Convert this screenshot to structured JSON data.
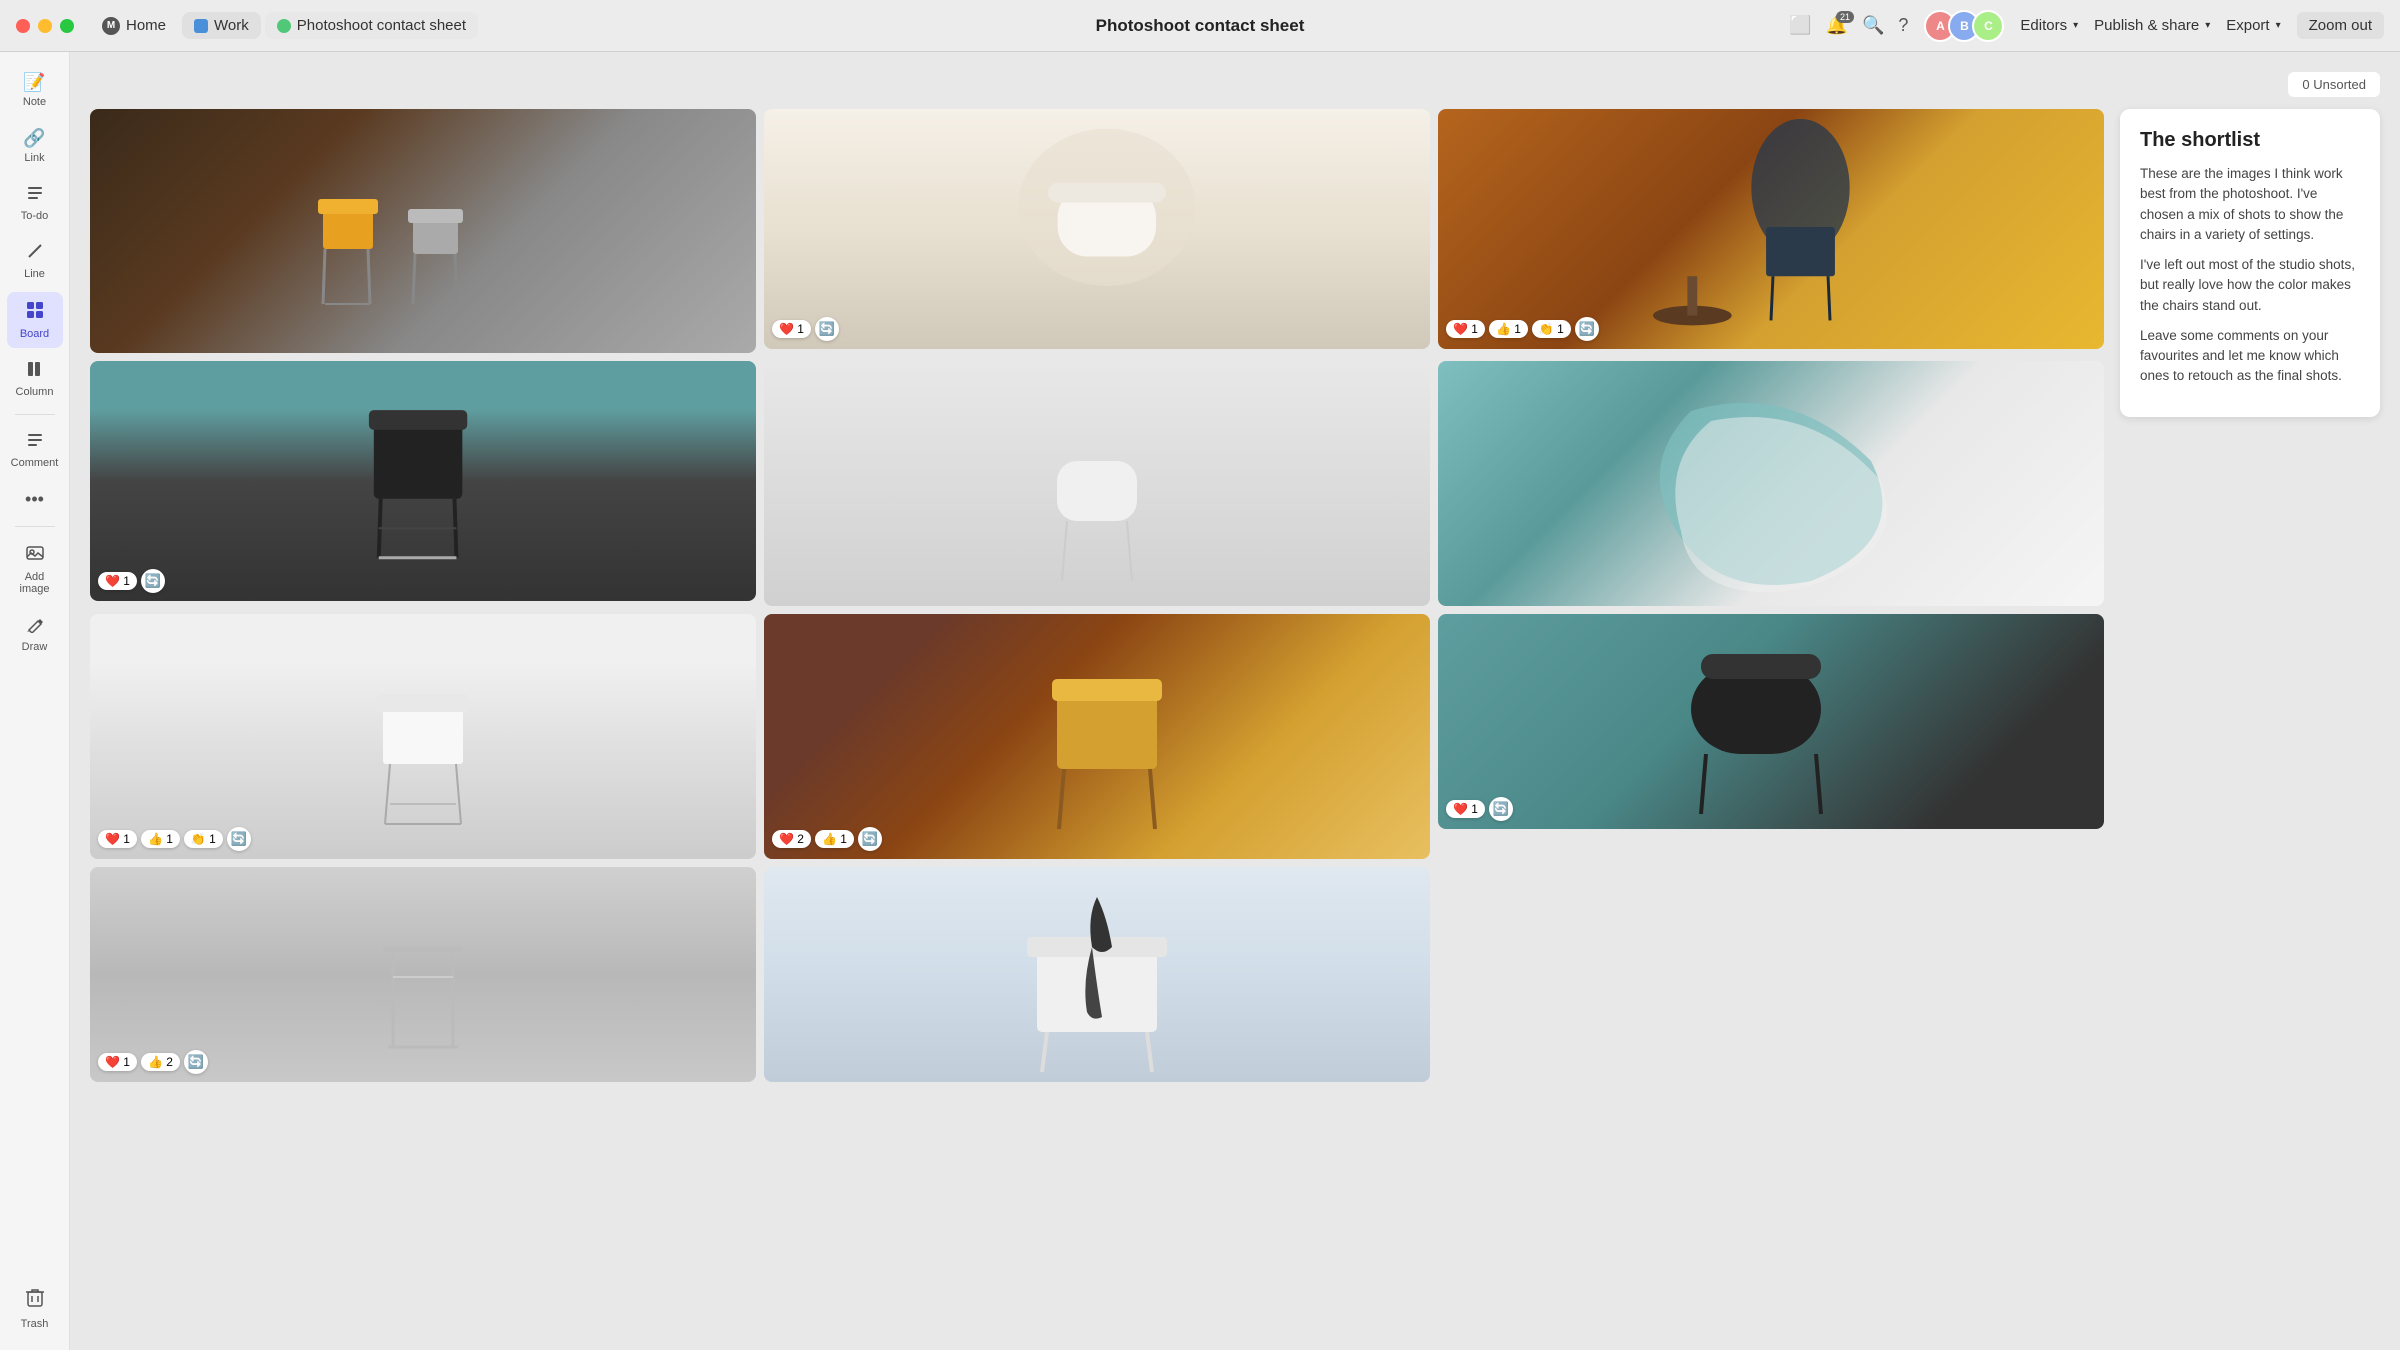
{
  "titlebar": {
    "tabs": [
      {
        "id": "home",
        "label": "Home",
        "icon": "M"
      },
      {
        "id": "work",
        "label": "Work",
        "icon": "work"
      },
      {
        "id": "doc",
        "label": "Photoshoot contact sheet",
        "icon": "doc"
      }
    ],
    "center_title": "Photoshoot contact sheet",
    "notification_count": "21",
    "editors_label": "Editors",
    "publish_label": "Publish & share",
    "export_label": "Export",
    "zoomout_label": "Zoom out"
  },
  "sidebar": {
    "items": [
      {
        "id": "note",
        "label": "Note",
        "icon": "☰"
      },
      {
        "id": "link",
        "label": "Link",
        "icon": "🔗"
      },
      {
        "id": "todo",
        "label": "To-do",
        "icon": "≡"
      },
      {
        "id": "line",
        "label": "Line",
        "icon": "/"
      },
      {
        "id": "board",
        "label": "Board",
        "icon": "⊞",
        "active": true
      },
      {
        "id": "column",
        "label": "Column",
        "icon": "▦"
      },
      {
        "id": "comment",
        "label": "Comment",
        "icon": "≡"
      },
      {
        "id": "more",
        "label": "",
        "icon": "•••"
      },
      {
        "id": "addimage",
        "label": "Add image",
        "icon": "🖼"
      },
      {
        "id": "draw",
        "label": "Draw",
        "icon": "✏"
      }
    ],
    "trash_label": "Trash"
  },
  "content": {
    "unsorted_label": "0 Unsorted",
    "images": [
      {
        "id": 1,
        "alt": "Yellow and grey chairs on dark background",
        "reactions": []
      },
      {
        "id": 2,
        "alt": "White chair closeup",
        "reactions": [
          {
            "emoji": "❤️",
            "count": "1"
          },
          {
            "emoji": "🔄",
            "count": ""
          }
        ]
      },
      {
        "id": 3,
        "alt": "Blue chairs with table on orange background",
        "reactions": [
          {
            "emoji": "❤️",
            "count": "1"
          },
          {
            "emoji": "👍",
            "count": "1"
          },
          {
            "emoji": "👏",
            "count": "1"
          },
          {
            "emoji": "🔄",
            "count": ""
          }
        ]
      },
      {
        "id": 4,
        "alt": "Black chair on teal background",
        "reactions": [
          {
            "emoji": "❤️",
            "count": "1"
          },
          {
            "emoji": "🔄",
            "count": ""
          }
        ]
      },
      {
        "id": 5,
        "alt": "White minimal chair shadow",
        "reactions": []
      },
      {
        "id": 6,
        "alt": "Teal and white organic chair closeup",
        "reactions": []
      },
      {
        "id": 7,
        "alt": "White chair on light background",
        "reactions": [
          {
            "emoji": "❤️",
            "count": "1"
          },
          {
            "emoji": "👍",
            "count": "1"
          },
          {
            "emoji": "👏",
            "count": "1"
          },
          {
            "emoji": "🔄",
            "count": ""
          }
        ]
      },
      {
        "id": 8,
        "alt": "Yellow chair on brown background",
        "reactions": [
          {
            "emoji": "❤️",
            "count": "2"
          },
          {
            "emoji": "👍",
            "count": "1"
          },
          {
            "emoji": "🔄",
            "count": ""
          }
        ]
      },
      {
        "id": 9,
        "alt": "Black chair on teal bottom",
        "reactions": [
          {
            "emoji": "❤️",
            "count": "1"
          },
          {
            "emoji": "🔄",
            "count": ""
          }
        ]
      },
      {
        "id": 10,
        "alt": "White minimal chair light background",
        "reactions": [
          {
            "emoji": "❤️",
            "count": "1"
          },
          {
            "emoji": "👍",
            "count": "2"
          },
          {
            "emoji": "🔄",
            "count": ""
          }
        ]
      },
      {
        "id": 11,
        "alt": "White chair with black cloth drape",
        "reactions": []
      }
    ]
  },
  "shortlist": {
    "title": "The shortlist",
    "paragraphs": [
      "These are the images I think work best from the photoshoot. I've chosen a mix of shots to show the chairs in a variety of settings.",
      "I've left out most of the studio shots, but really love how the color makes the chairs stand out.",
      "Leave some comments on your favourites and let me know which ones to retouch as the final shots."
    ]
  },
  "icons": {
    "note": "☰",
    "link": "🔗",
    "todo": "≡",
    "line": "/",
    "board": "▦",
    "column": "▥",
    "comment": "≡",
    "more": "•••",
    "addimage": "⬜",
    "draw": "✏",
    "trash": "🗑",
    "search": "🔍",
    "bell": "🔔",
    "question": "?"
  }
}
